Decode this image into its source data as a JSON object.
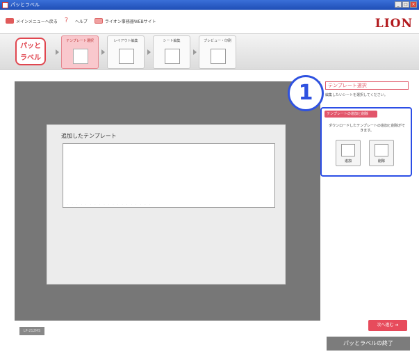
{
  "window": {
    "title": "パッとラベル",
    "min": "_",
    "max": "□",
    "close": "×"
  },
  "menu": {
    "back": "メインメニューへ戻る",
    "help": "ヘルプ",
    "web": "ライオン事務器WEBサイト"
  },
  "brand": "LION",
  "logo": {
    "line1": "パッと",
    "line2": "ラベル"
  },
  "steps": [
    {
      "label": "テンプレート選択",
      "active": true
    },
    {
      "label": "レイアウト編集",
      "active": false
    },
    {
      "label": "シート編集",
      "active": false
    },
    {
      "label": "プレビュー・印刷",
      "active": false
    }
  ],
  "main": {
    "heading": "追加したテンプレート",
    "model": "LP-212MS"
  },
  "side": {
    "step_number": "1",
    "select_title": "テンプレート選択",
    "select_desc": "編集したいシートを選択してください。",
    "add_header": "テンプレートの追加と削除",
    "add_desc": "ダウンロードしたテンプレートの追加と削除ができます。",
    "add_label": "追加",
    "delete_label": "削除"
  },
  "buttons": {
    "next": "次へ進む ➔",
    "exit": "パッとラベルの終了"
  },
  "colors": {
    "accent": "#e74b5c",
    "highlight": "#2c4ee6",
    "brand": "#b2191d"
  }
}
